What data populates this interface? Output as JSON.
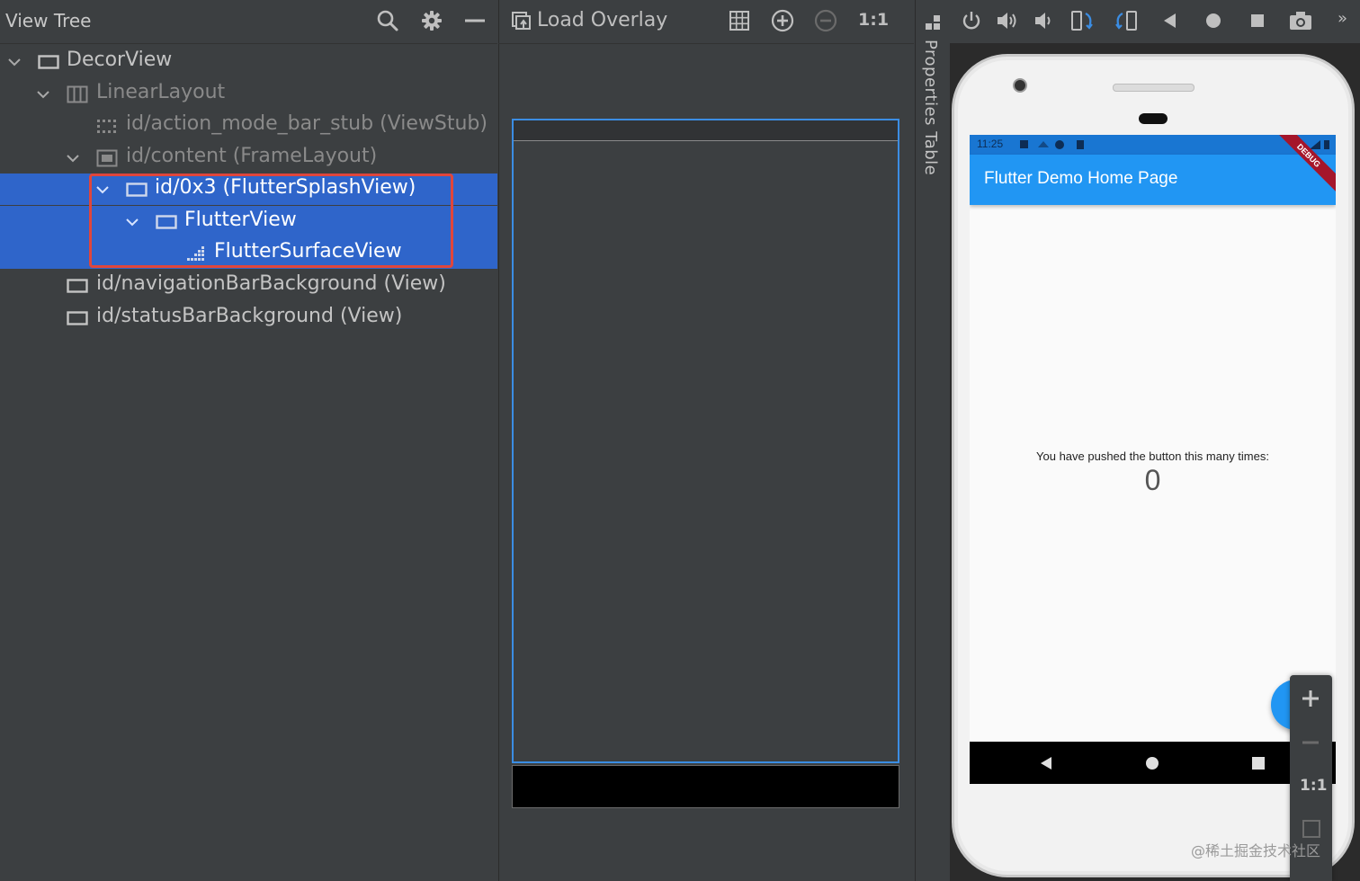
{
  "left_panel": {
    "title": "View Tree",
    "tree": [
      {
        "label": "DecorView",
        "dim": false
      },
      {
        "label": "LinearLayout",
        "dim": true
      },
      {
        "label": "id/action_mode_bar_stub (ViewStub)",
        "dim": true
      },
      {
        "label": "id/content (FrameLayout)",
        "dim": true
      },
      {
        "label": "id/0x3 (FlutterSplashView)",
        "selected": true
      },
      {
        "label": "FlutterView",
        "selected": true
      },
      {
        "label": "FlutterSurfaceView",
        "selected": true
      },
      {
        "label": "id/navigationBarBackground (View)",
        "dim": false
      },
      {
        "label": "id/statusBarBackground (View)",
        "dim": false
      }
    ]
  },
  "middle_panel": {
    "load_overlay_label": "Load Overlay",
    "actual_size_label": "1:1"
  },
  "side_strip": {
    "properties_label": "Properties Table"
  },
  "emulator": {
    "status_time": "11:25",
    "debug_banner": "DEBUG",
    "app_title": "Flutter Demo Home Page",
    "counter_text": "You have pushed the button this many times:",
    "counter_value": "0",
    "zoom_actual_label": "1:1",
    "overflow_label": "»"
  },
  "watermark": "@稀土掘金技术社区",
  "colors": {
    "selection": "#2f65ca",
    "highlight_border": "#e0463b",
    "app_bar": "#2196f3",
    "status_bar": "#1976d2"
  }
}
